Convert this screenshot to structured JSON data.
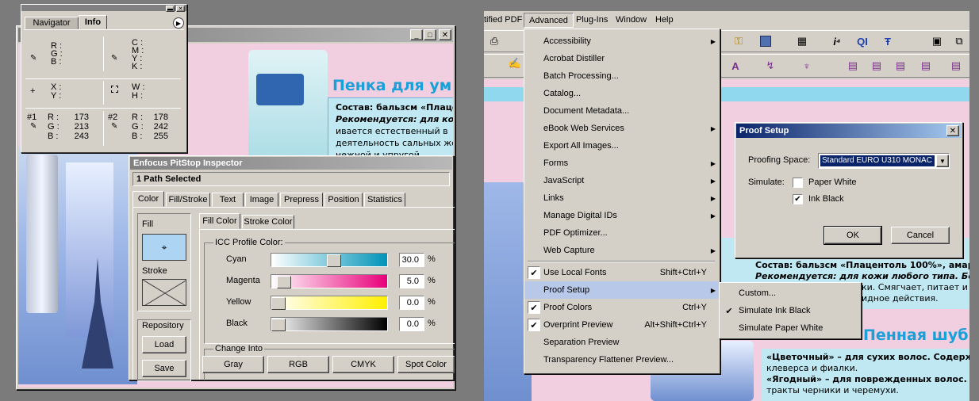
{
  "left": {
    "doc_heading": "Пенка для ум",
    "doc_lines": [
      "Состав: бальзсм «Плаце",
      "Рекомендуется: для кож",
      "ивается естественный в",
      "деятельность сальных же",
      "нежной и упругой."
    ],
    "navigator": {
      "tabs": [
        "Navigator",
        "Info"
      ],
      "rgb_labels": [
        "R :",
        "G :",
        "B :"
      ],
      "cmyk_labels": [
        "C :",
        "M :",
        "Y :",
        "K :"
      ],
      "xy_labels": [
        "X :",
        "Y :"
      ],
      "wh_labels": [
        "W :",
        "H :"
      ],
      "s1_label": "#1",
      "s1": [
        {
          "k": "R :",
          "v": "173"
        },
        {
          "k": "G :",
          "v": "213"
        },
        {
          "k": "B :",
          "v": "243"
        }
      ],
      "s2_label": "#2",
      "s2": [
        {
          "k": "R :",
          "v": "178"
        },
        {
          "k": "G :",
          "v": "242"
        },
        {
          "k": "B :",
          "v": "255"
        }
      ]
    },
    "inspector": {
      "title": "Enfocus PitStop Inspector",
      "selection": "1 Path Selected",
      "tabs": [
        "Color",
        "Fill/Stroke",
        "Text",
        "Image",
        "Prepress",
        "Position",
        "Statistics"
      ],
      "fill_label": "Fill",
      "stroke_label": "Stroke",
      "repository_label": "Repository",
      "load_label": "Load",
      "save_label": "Save",
      "subtabs": [
        "Fill Color",
        "Stroke Color"
      ],
      "icc_label": "ICC Profile Color:",
      "channels": [
        {
          "name": "Cyan",
          "value": "30.0",
          "unit": "%",
          "level": 0.3
        },
        {
          "name": "Magenta",
          "value": "5.0",
          "unit": "%",
          "level": 0.05
        },
        {
          "name": "Yellow",
          "value": "0.0",
          "unit": "%",
          "level": 0.0
        },
        {
          "name": "Black",
          "value": "0.0",
          "unit": "%",
          "level": 0.0
        }
      ],
      "change_into_label": "Change Into",
      "change_buttons": [
        "Gray",
        "RGB",
        "CMYK",
        "Spot Color"
      ]
    }
  },
  "right": {
    "menubar": [
      "tified PDF",
      "Advanced",
      "Plug-Ins",
      "Window",
      "Help"
    ],
    "menu": [
      {
        "label": "Accessibility",
        "submenu": true
      },
      {
        "label": "Acrobat Distiller"
      },
      {
        "label": "Batch Processing..."
      },
      {
        "label": "Catalog..."
      },
      {
        "label": "Document Metadata..."
      },
      {
        "label": "eBook Web Services",
        "submenu": true
      },
      {
        "label": "Export All Images..."
      },
      {
        "label": "Forms",
        "submenu": true
      },
      {
        "label": "JavaScript",
        "submenu": true
      },
      {
        "label": "Links",
        "submenu": true
      },
      {
        "label": "Manage Digital IDs",
        "submenu": true
      },
      {
        "label": "PDF Optimizer..."
      },
      {
        "label": "Web Capture",
        "submenu": true
      },
      {
        "label": "Use Local Fonts",
        "shortcut": "Shift+Ctrl+Y",
        "checked": true
      },
      {
        "label": "Proof Setup",
        "submenu": true,
        "highlighted": true
      },
      {
        "label": "Proof Colors",
        "shortcut": "Ctrl+Y",
        "checked": true
      },
      {
        "label": "Overprint Preview",
        "shortcut": "Alt+Shift+Ctrl+Y",
        "checked": true
      },
      {
        "label": "Separation Preview"
      },
      {
        "label": "Transparency Flattener Preview..."
      }
    ],
    "submenu": [
      {
        "label": "Custom..."
      },
      {
        "label": "Simulate Ink Black",
        "checked": true
      },
      {
        "label": "Simulate Paper White"
      }
    ],
    "dialog": {
      "title": "Proof Setup",
      "space_label": "Proofing Space:",
      "space_value": "Standard EURO U310 MONAC",
      "simulate_label": "Simulate:",
      "paper_white": "Paper White",
      "ink_black": "Ink Black",
      "ok": "OK",
      "cancel": "Cancel"
    },
    "doc_lines": [
      "Состав: бальзсм «Плацентоль 100%», амаран",
      "Рекомендуется: для кожи любого типа. Бер",
      "ки. Смягчает, питает и то",
      "идное действия."
    ],
    "doc_heading2": "Пенная шуб",
    "doc_lines2": [
      "«Цветочный» – для сухих волос. Содержит:",
      "клеверса и фиалки.",
      "«Ягодный» – для поврежденных волос. Соде",
      "тракты черники и черемухи."
    ]
  }
}
